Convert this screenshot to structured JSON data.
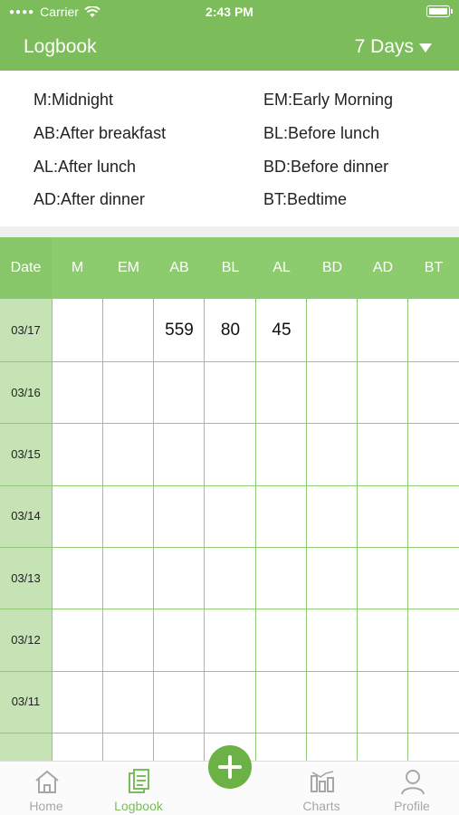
{
  "status": {
    "carrier": "Carrier",
    "time": "2:43 PM"
  },
  "nav": {
    "title": "Logbook",
    "range": "7 Days"
  },
  "legend": [
    "M:Midnight",
    "EM:Early Morning",
    "AB:After breakfast",
    "BL:Before lunch",
    "AL:After lunch",
    "BD:Before dinner",
    "AD:After dinner",
    "BT:Bedtime"
  ],
  "table": {
    "headers": [
      "Date",
      "M",
      "EM",
      "AB",
      "BL",
      "AL",
      "BD",
      "AD",
      "BT"
    ],
    "rows": [
      {
        "date": "03/17",
        "values": [
          "",
          "",
          "559",
          "80",
          "45",
          "",
          "",
          ""
        ]
      },
      {
        "date": "03/16",
        "values": [
          "",
          "",
          "",
          "",
          "",
          "",
          "",
          ""
        ]
      },
      {
        "date": "03/15",
        "values": [
          "",
          "",
          "",
          "",
          "",
          "",
          "",
          ""
        ]
      },
      {
        "date": "03/14",
        "values": [
          "",
          "",
          "",
          "",
          "",
          "",
          "",
          ""
        ]
      },
      {
        "date": "03/13",
        "values": [
          "",
          "",
          "",
          "",
          "",
          "",
          "",
          ""
        ]
      },
      {
        "date": "03/12",
        "values": [
          "",
          "",
          "",
          "",
          "",
          "",
          "",
          ""
        ]
      },
      {
        "date": "03/11",
        "values": [
          "",
          "",
          "",
          "",
          "",
          "",
          "",
          ""
        ]
      }
    ]
  },
  "tabs": [
    {
      "label": "Home",
      "icon": "home-icon"
    },
    {
      "label": "Logbook",
      "icon": "logbook-icon",
      "active": true
    },
    {
      "label": "Charts",
      "icon": "charts-icon"
    },
    {
      "label": "Profile",
      "icon": "profile-icon"
    }
  ],
  "colors": {
    "primary": "#7cbc5a",
    "header": "#8ccb6e",
    "date_column": "#c6e3b6",
    "fab": "#6bb146"
  }
}
